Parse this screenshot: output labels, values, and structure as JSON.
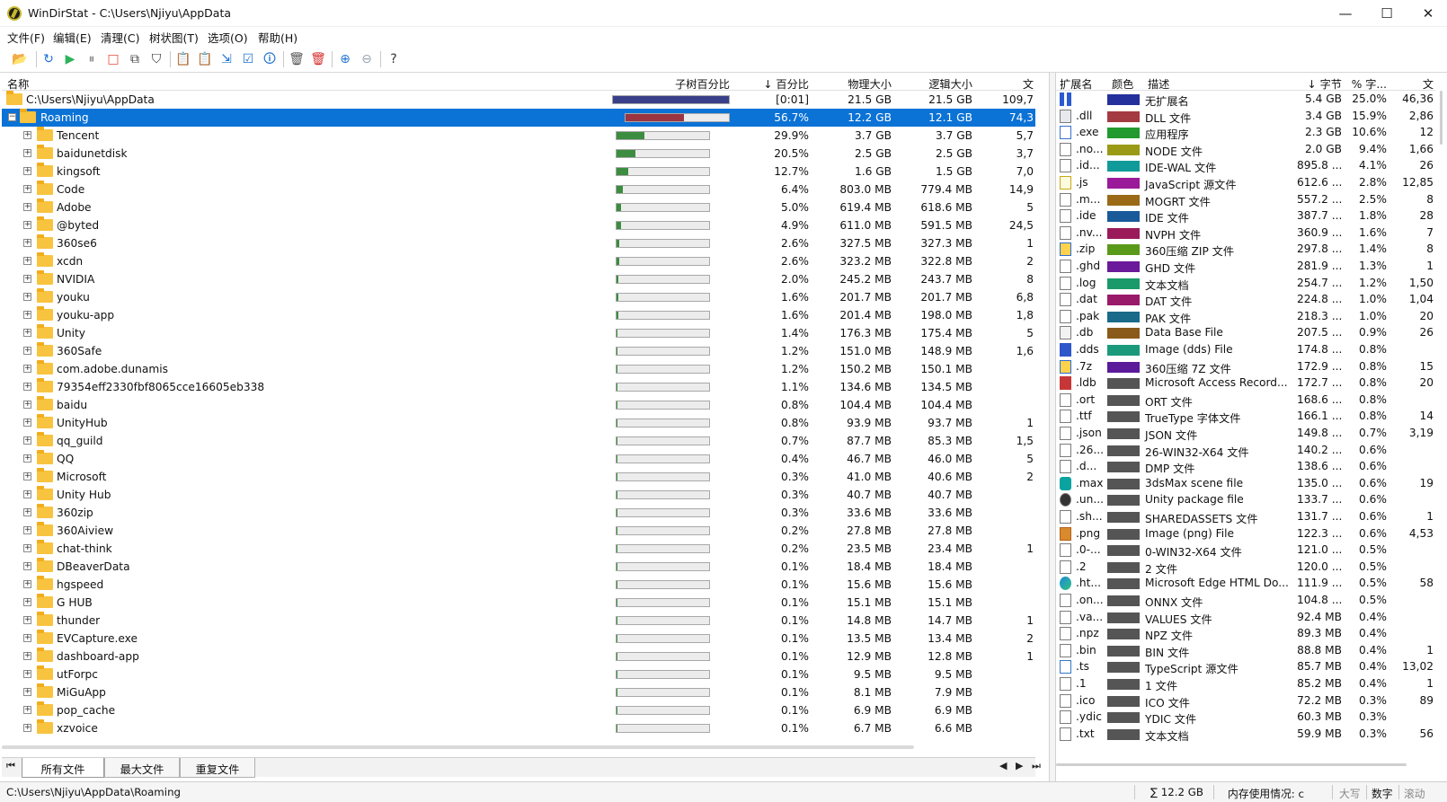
{
  "window": {
    "title": "WinDirStat - C:\\Users\\Njiyu\\AppData",
    "min_glyph": "—",
    "max_glyph": "☐",
    "close_glyph": "✕"
  },
  "menu": [
    "文件(F)",
    "编辑(E)",
    "清理(C)",
    "树状图(T)",
    "选项(O)",
    "帮助(H)"
  ],
  "toolbar": [
    {
      "icon": "open-folder-icon",
      "glyph": "📂",
      "color": "#d6a522"
    },
    {
      "icon": "refresh-icon",
      "glyph": "↻",
      "color": "#1d6fd8"
    },
    {
      "icon": "play-icon",
      "glyph": "▶",
      "color": "#2db35b"
    },
    {
      "icon": "pause-icon",
      "glyph": "⏸",
      "color": "#8e8e8e"
    },
    {
      "icon": "stop-icon",
      "glyph": "□",
      "color": "#e74c3c"
    },
    {
      "icon": "copy-path-icon",
      "glyph": "⧉",
      "color": "#444"
    },
    {
      "icon": "filter-icon",
      "glyph": "⛉",
      "color": "#333"
    },
    {
      "icon": "copy-icon",
      "glyph": "📋",
      "color": "#3b7e38"
    },
    {
      "icon": "paste-icon",
      "glyph": "📋",
      "color": "#c08a22"
    },
    {
      "icon": "select-icon",
      "glyph": "⇲",
      "color": "#2475d1"
    },
    {
      "icon": "properties-icon",
      "glyph": "☑",
      "color": "#2475d1"
    },
    {
      "icon": "info-icon",
      "glyph": "🛈",
      "color": "#2475d1"
    },
    {
      "icon": "recycle-bin-icon",
      "glyph": "🗑",
      "color": "#555"
    },
    {
      "icon": "delete-icon",
      "glyph": "🗑",
      "color": "#d62c2c"
    },
    {
      "icon": "zoom-in-icon",
      "glyph": "⊕",
      "color": "#2475d1"
    },
    {
      "icon": "zoom-out-icon",
      "glyph": "⊖",
      "color": "#9aa4b5"
    },
    {
      "icon": "help-icon",
      "glyph": "?",
      "color": "#333"
    }
  ],
  "tree": {
    "columns": [
      "名称",
      "子树百分比",
      "↓ 百分比",
      "物理大小",
      "逻辑大小",
      "文"
    ],
    "root": {
      "name": "C:\\Users\\Njiyu\\AppData",
      "percent": "[0:01]",
      "physical": "21.5 GB",
      "logical": "21.5 GB",
      "files": "109,7",
      "bar": 1.0,
      "bar_color": "#3a3f8a"
    },
    "selected": {
      "name": "Roaming",
      "percent": "56.7%",
      "physical": "12.2 GB",
      "logical": "12.1 GB",
      "files": "74,3",
      "bar": 0.567,
      "bar_color": "#9b3541"
    },
    "rows": [
      {
        "name": "Tencent",
        "percent": "29.9%",
        "physical": "3.7 GB",
        "logical": "3.7 GB",
        "files": "5,7",
        "bar": 0.299
      },
      {
        "name": "baidunetdisk",
        "percent": "20.5%",
        "physical": "2.5 GB",
        "logical": "2.5 GB",
        "files": "3,7",
        "bar": 0.205
      },
      {
        "name": "kingsoft",
        "percent": "12.7%",
        "physical": "1.6 GB",
        "logical": "1.5 GB",
        "files": "7,0",
        "bar": 0.127
      },
      {
        "name": "Code",
        "percent": "6.4%",
        "physical": "803.0 MB",
        "logical": "779.4 MB",
        "files": "14,9",
        "bar": 0.064
      },
      {
        "name": "Adobe",
        "percent": "5.0%",
        "physical": "619.4 MB",
        "logical": "618.6 MB",
        "files": "5",
        "bar": 0.05
      },
      {
        "name": "@byted",
        "percent": "4.9%",
        "physical": "611.0 MB",
        "logical": "591.5 MB",
        "files": "24,5",
        "bar": 0.049
      },
      {
        "name": "360se6",
        "percent": "2.6%",
        "physical": "327.5 MB",
        "logical": "327.3 MB",
        "files": "1",
        "bar": 0.026
      },
      {
        "name": "xcdn",
        "percent": "2.6%",
        "physical": "323.2 MB",
        "logical": "322.8 MB",
        "files": "2",
        "bar": 0.026
      },
      {
        "name": "NVIDIA",
        "percent": "2.0%",
        "physical": "245.2 MB",
        "logical": "243.7 MB",
        "files": "8",
        "bar": 0.02
      },
      {
        "name": "youku",
        "percent": "1.6%",
        "physical": "201.7 MB",
        "logical": "201.7 MB",
        "files": "6,8",
        "bar": 0.016
      },
      {
        "name": "youku-app",
        "percent": "1.6%",
        "physical": "201.4 MB",
        "logical": "198.0 MB",
        "files": "1,8",
        "bar": 0.016
      },
      {
        "name": "Unity",
        "percent": "1.4%",
        "physical": "176.3 MB",
        "logical": "175.4 MB",
        "files": "5",
        "bar": 0.014
      },
      {
        "name": "360Safe",
        "percent": "1.2%",
        "physical": "151.0 MB",
        "logical": "148.9 MB",
        "files": "1,6",
        "bar": 0.012
      },
      {
        "name": "com.adobe.dunamis",
        "percent": "1.2%",
        "physical": "150.2 MB",
        "logical": "150.1 MB",
        "files": "",
        "bar": 0.012
      },
      {
        "name": "79354eff2330fbf8065cce16605eb338",
        "percent": "1.1%",
        "physical": "134.6 MB",
        "logical": "134.5 MB",
        "files": "",
        "bar": 0.011
      },
      {
        "name": "baidu",
        "percent": "0.8%",
        "physical": "104.4 MB",
        "logical": "104.4 MB",
        "files": "",
        "bar": 0.008
      },
      {
        "name": "UnityHub",
        "percent": "0.8%",
        "physical": "93.9 MB",
        "logical": "93.7 MB",
        "files": "1",
        "bar": 0.008
      },
      {
        "name": "qq_guild",
        "percent": "0.7%",
        "physical": "87.7 MB",
        "logical": "85.3 MB",
        "files": "1,5",
        "bar": 0.007
      },
      {
        "name": "QQ",
        "percent": "0.4%",
        "physical": "46.7 MB",
        "logical": "46.0 MB",
        "files": "5",
        "bar": 0.004
      },
      {
        "name": "Microsoft",
        "percent": "0.3%",
        "physical": "41.0 MB",
        "logical": "40.6 MB",
        "files": "2",
        "bar": 0.003
      },
      {
        "name": "Unity Hub",
        "percent": "0.3%",
        "physical": "40.7 MB",
        "logical": "40.7 MB",
        "files": "",
        "bar": 0.003
      },
      {
        "name": "360zip",
        "percent": "0.3%",
        "physical": "33.6 MB",
        "logical": "33.6 MB",
        "files": "",
        "bar": 0.003
      },
      {
        "name": "360Aiview",
        "percent": "0.2%",
        "physical": "27.8 MB",
        "logical": "27.8 MB",
        "files": "",
        "bar": 0.002
      },
      {
        "name": "chat-think",
        "percent": "0.2%",
        "physical": "23.5 MB",
        "logical": "23.4 MB",
        "files": "1",
        "bar": 0.002
      },
      {
        "name": "DBeaverData",
        "percent": "0.1%",
        "physical": "18.4 MB",
        "logical": "18.4 MB",
        "files": "",
        "bar": 0.001
      },
      {
        "name": "hgspeed",
        "percent": "0.1%",
        "physical": "15.6 MB",
        "logical": "15.6 MB",
        "files": "",
        "bar": 0.001
      },
      {
        "name": "G HUB",
        "percent": "0.1%",
        "physical": "15.1 MB",
        "logical": "15.1 MB",
        "files": "",
        "bar": 0.001
      },
      {
        "name": "thunder",
        "percent": "0.1%",
        "physical": "14.8 MB",
        "logical": "14.7 MB",
        "files": "1",
        "bar": 0.001
      },
      {
        "name": "EVCapture.exe",
        "percent": "0.1%",
        "physical": "13.5 MB",
        "logical": "13.4 MB",
        "files": "2",
        "bar": 0.001
      },
      {
        "name": "dashboard-app",
        "percent": "0.1%",
        "physical": "12.9 MB",
        "logical": "12.8 MB",
        "files": "1",
        "bar": 0.001
      },
      {
        "name": "utForpc",
        "percent": "0.1%",
        "physical": "9.5 MB",
        "logical": "9.5 MB",
        "files": "",
        "bar": 0.001
      },
      {
        "name": "MiGuApp",
        "percent": "0.1%",
        "physical": "8.1 MB",
        "logical": "7.9 MB",
        "files": "",
        "bar": 0.001
      },
      {
        "name": "pop_cache",
        "percent": "0.1%",
        "physical": "6.9 MB",
        "logical": "6.9 MB",
        "files": "",
        "bar": 0.001
      },
      {
        "name": "xzvoice",
        "percent": "0.1%",
        "physical": "6.7 MB",
        "logical": "6.6 MB",
        "files": "",
        "bar": 0.001
      }
    ]
  },
  "tabs": [
    "所有文件",
    "最大文件",
    "重复文件"
  ],
  "ext": {
    "columns": [
      "扩展名",
      "颜色",
      "描述",
      "↓ 字节",
      "% 字...",
      "文"
    ],
    "rows": [
      {
        "ext": "",
        "color": "#24309b",
        "desc": "无扩展名",
        "bytes": "5.4 GB",
        "pct": "25.0%",
        "files": "46,36",
        "icon": "grid"
      },
      {
        "ext": ".dll",
        "color": "#a43a42",
        "desc": "DLL 文件",
        "bytes": "3.4 GB",
        "pct": "15.9%",
        "files": "2,86",
        "icon": "dll"
      },
      {
        "ext": ".exe",
        "color": "#239a2f",
        "desc": "应用程序",
        "bytes": "2.3 GB",
        "pct": "10.6%",
        "files": "12",
        "icon": "exe"
      },
      {
        "ext": ".no...",
        "color": "#9a9a16",
        "desc": "NODE 文件",
        "bytes": "2.0 GB",
        "pct": "9.4%",
        "files": "1,66",
        "icon": "file"
      },
      {
        "ext": ".id...",
        "color": "#119a9a",
        "desc": "IDE-WAL 文件",
        "bytes": "895.8 ...",
        "pct": "4.1%",
        "files": "26",
        "icon": "file"
      },
      {
        "ext": ".js",
        "color": "#9a1a9a",
        "desc": "JavaScript 源文件",
        "bytes": "612.6 ...",
        "pct": "2.8%",
        "files": "12,85",
        "icon": "js"
      },
      {
        "ext": ".m...",
        "color": "#9a6a16",
        "desc": "MOGRT 文件",
        "bytes": "557.2 ...",
        "pct": "2.5%",
        "files": "8",
        "icon": "file"
      },
      {
        "ext": ".ide",
        "color": "#1a5a9a",
        "desc": "IDE 文件",
        "bytes": "387.7 ...",
        "pct": "1.8%",
        "files": "28",
        "icon": "file"
      },
      {
        "ext": ".nv...",
        "color": "#9a1a5a",
        "desc": "NVPH 文件",
        "bytes": "360.9 ...",
        "pct": "1.6%",
        "files": "7",
        "icon": "file"
      },
      {
        "ext": ".zip",
        "color": "#5a9a1a",
        "desc": "360压缩 ZIP 文件",
        "bytes": "297.8 ...",
        "pct": "1.4%",
        "files": "8",
        "icon": "zip"
      },
      {
        "ext": ".ghd",
        "color": "#6a1a9a",
        "desc": "GHD 文件",
        "bytes": "281.9 ...",
        "pct": "1.3%",
        "files": "1",
        "icon": "file"
      },
      {
        "ext": ".log",
        "color": "#1a9a6a",
        "desc": "文本文档",
        "bytes": "254.7 ...",
        "pct": "1.2%",
        "files": "1,50",
        "icon": "file"
      },
      {
        "ext": ".dat",
        "color": "#9a1a6a",
        "desc": "DAT 文件",
        "bytes": "224.8 ...",
        "pct": "1.0%",
        "files": "1,04",
        "icon": "file"
      },
      {
        "ext": ".pak",
        "color": "#1a6a8a",
        "desc": "PAK 文件",
        "bytes": "218.3 ...",
        "pct": "1.0%",
        "files": "20",
        "icon": "file"
      },
      {
        "ext": ".db",
        "color": "#8a5a1a",
        "desc": "Data Base File",
        "bytes": "207.5 ...",
        "pct": "0.9%",
        "files": "26",
        "icon": "db"
      },
      {
        "ext": ".dds",
        "color": "#1a9a7a",
        "desc": "Image (dds) File",
        "bytes": "174.8 ...",
        "pct": "0.8%",
        "files": "",
        "icon": "dds"
      },
      {
        "ext": ".7z",
        "color": "#5a1a9a",
        "desc": "360压缩 7Z 文件",
        "bytes": "172.9 ...",
        "pct": "0.8%",
        "files": "15",
        "icon": "zip"
      },
      {
        "ext": ".ldb",
        "color": "#555555",
        "desc": "Microsoft Access Record...",
        "bytes": "172.7 ...",
        "pct": "0.8%",
        "files": "20",
        "icon": "access"
      },
      {
        "ext": ".ort",
        "color": "#555555",
        "desc": "ORT 文件",
        "bytes": "168.6 ...",
        "pct": "0.8%",
        "files": "",
        "icon": "file"
      },
      {
        "ext": ".ttf",
        "color": "#555555",
        "desc": "TrueType 字体文件",
        "bytes": "166.1 ...",
        "pct": "0.8%",
        "files": "14",
        "icon": "font"
      },
      {
        "ext": ".json",
        "color": "#555555",
        "desc": "JSON 文件",
        "bytes": "149.8 ...",
        "pct": "0.7%",
        "files": "3,19",
        "icon": "file"
      },
      {
        "ext": ".26...",
        "color": "#555555",
        "desc": "26-WIN32-X64 文件",
        "bytes": "140.2 ...",
        "pct": "0.6%",
        "files": "",
        "icon": "file"
      },
      {
        "ext": ".d...",
        "color": "#555555",
        "desc": "DMP 文件",
        "bytes": "138.6 ...",
        "pct": "0.6%",
        "files": "",
        "icon": "file"
      },
      {
        "ext": ".max",
        "color": "#555555",
        "desc": "3dsMax scene file",
        "bytes": "135.0 ...",
        "pct": "0.6%",
        "files": "19",
        "icon": "max"
      },
      {
        "ext": ".un...",
        "color": "#555555",
        "desc": "Unity package file",
        "bytes": "133.7 ...",
        "pct": "0.6%",
        "files": "",
        "icon": "unity"
      },
      {
        "ext": ".sh...",
        "color": "#555555",
        "desc": "SHAREDASSETS 文件",
        "bytes": "131.7 ...",
        "pct": "0.6%",
        "files": "1",
        "icon": "file"
      },
      {
        "ext": ".png",
        "color": "#555555",
        "desc": "Image (png) File",
        "bytes": "122.3 ...",
        "pct": "0.6%",
        "files": "4,53",
        "icon": "png"
      },
      {
        "ext": ".0-...",
        "color": "#555555",
        "desc": "0-WIN32-X64 文件",
        "bytes": "121.0 ...",
        "pct": "0.5%",
        "files": "",
        "icon": "file"
      },
      {
        "ext": ".2",
        "color": "#555555",
        "desc": "2 文件",
        "bytes": "120.0 ...",
        "pct": "0.5%",
        "files": "",
        "icon": "file"
      },
      {
        "ext": ".ht...",
        "color": "#555555",
        "desc": "Microsoft Edge HTML Do...",
        "bytes": "111.9 ...",
        "pct": "0.5%",
        "files": "58",
        "icon": "edge"
      },
      {
        "ext": ".on...",
        "color": "#555555",
        "desc": "ONNX 文件",
        "bytes": "104.8 ...",
        "pct": "0.5%",
        "files": "",
        "icon": "file"
      },
      {
        "ext": ".va...",
        "color": "#555555",
        "desc": "VALUES 文件",
        "bytes": "92.4 MB",
        "pct": "0.4%",
        "files": "",
        "icon": "file"
      },
      {
        "ext": ".npz",
        "color": "#555555",
        "desc": "NPZ 文件",
        "bytes": "89.3 MB",
        "pct": "0.4%",
        "files": "",
        "icon": "file"
      },
      {
        "ext": ".bin",
        "color": "#555555",
        "desc": "BIN 文件",
        "bytes": "88.8 MB",
        "pct": "0.4%",
        "files": "1",
        "icon": "file"
      },
      {
        "ext": ".ts",
        "color": "#555555",
        "desc": "TypeScript 源文件",
        "bytes": "85.7 MB",
        "pct": "0.4%",
        "files": "13,02",
        "icon": "ts"
      },
      {
        "ext": ".1",
        "color": "#555555",
        "desc": "1 文件",
        "bytes": "85.2 MB",
        "pct": "0.4%",
        "files": "1",
        "icon": "file"
      },
      {
        "ext": ".ico",
        "color": "#555555",
        "desc": "ICO 文件",
        "bytes": "72.2 MB",
        "pct": "0.3%",
        "files": "89",
        "icon": "file"
      },
      {
        "ext": ".ydic",
        "color": "#555555",
        "desc": "YDIC 文件",
        "bytes": "60.3 MB",
        "pct": "0.3%",
        "files": "",
        "icon": "file"
      },
      {
        "ext": ".txt",
        "color": "#555555",
        "desc": "文本文档",
        "bytes": "59.9 MB",
        "pct": "0.3%",
        "files": "56",
        "icon": "file"
      }
    ]
  },
  "status": {
    "path": "C:\\Users\\Njiyu\\AppData\\Roaming",
    "total": "∑ 12.2 GB",
    "memory": "内存使用情况:  c",
    "caps": "大写",
    "num": "数字",
    "scroll": "滚动"
  },
  "colors": {
    "bar_green": "#3c8d3f",
    "selection": "#0b72d6"
  }
}
